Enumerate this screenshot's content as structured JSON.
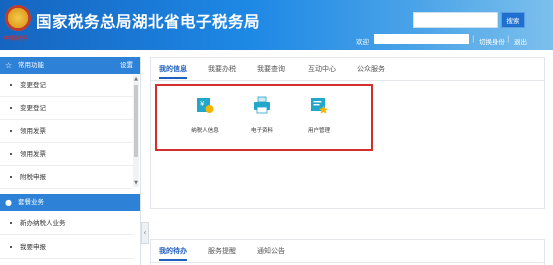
{
  "header": {
    "title": "国家税务总局湖北省电子税务局",
    "emblem_text": "中国税务",
    "search_button": "搜索",
    "welcome_label": "欢迎",
    "switch_identity": "切换身份",
    "logout": "退出",
    "separator": "|"
  },
  "sidebar": {
    "section1": {
      "label": "常用功能",
      "settings": "设置"
    },
    "items1": [
      {
        "label": "变更登记"
      },
      {
        "label": "变更登记"
      },
      {
        "label": "领用发票"
      },
      {
        "label": "领用发票"
      },
      {
        "label": "附税申报"
      }
    ],
    "section2": {
      "label": "套餐业务"
    },
    "items2": [
      {
        "label": "新办纳税人业务"
      },
      {
        "label": "我要申报"
      }
    ],
    "collapse_glyph": "‹"
  },
  "panel_top": {
    "tabs": [
      {
        "label": "我的信息",
        "active": true
      },
      {
        "label": "我要办税"
      },
      {
        "label": "我要查询"
      },
      {
        "label": "互动中心"
      },
      {
        "label": "公众服务"
      }
    ],
    "apps": [
      {
        "label": "纳税人信息",
        "icon": "taxpayer-info-icon"
      },
      {
        "label": "电子资料",
        "icon": "printer-icon"
      },
      {
        "label": "用户管理",
        "icon": "user-management-icon"
      }
    ]
  },
  "panel_bottom": {
    "tabs": [
      {
        "label": "我的待办",
        "active": true
      },
      {
        "label": "服务提醒"
      },
      {
        "label": "通知公告"
      }
    ]
  },
  "colors": {
    "brand_blue": "#1e88e5",
    "sidebar_head": "#2d82d8",
    "highlight_red": "#d32f2f",
    "tab_active": "#1f5fbf",
    "icon_teal": "#22a6c9",
    "icon_yellow": "#f5b400"
  }
}
